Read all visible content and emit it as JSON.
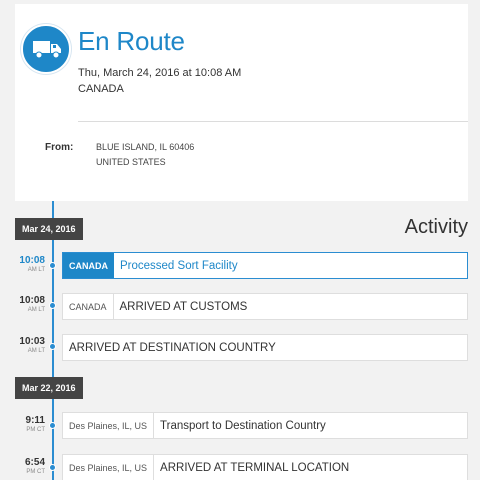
{
  "status": {
    "title": "En Route",
    "date": "Thu, March 24, 2016 at 10:08 AM",
    "country": "CANADA",
    "icon": "truck-icon",
    "accent_color": "#1e87c8"
  },
  "origin": {
    "label": "From:",
    "line1": "BLUE ISLAND, IL 60406",
    "line2": "UNITED STATES"
  },
  "activity": {
    "title": "Activity",
    "groups": [
      {
        "date": "Mar 24, 2016",
        "events": [
          {
            "time": "10:08",
            "zone": "AM LT",
            "location": "CANADA",
            "description": "Processed Sort Facility",
            "active": true
          },
          {
            "time": "10:08",
            "zone": "AM LT",
            "location": "CANADA",
            "description": "ARRIVED AT CUSTOMS",
            "active": false
          },
          {
            "time": "10:03",
            "zone": "AM LT",
            "location": "",
            "description": "ARRIVED AT DESTINATION COUNTRY",
            "active": false
          }
        ]
      },
      {
        "date": "Mar 22, 2016",
        "events": [
          {
            "time": "9:11",
            "zone": "PM CT",
            "location": "Des Plaines, IL, US",
            "description": "Transport to Destination Country",
            "active": false
          },
          {
            "time": "6:54",
            "zone": "PM CT",
            "location": "Des Plaines, IL, US",
            "description": "ARRIVED AT TERMINAL LOCATION",
            "active": false
          }
        ]
      }
    ]
  }
}
